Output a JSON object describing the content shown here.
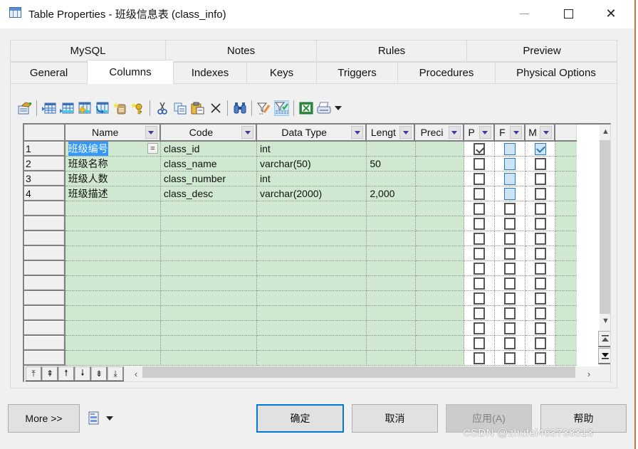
{
  "window": {
    "title": "Table Properties - 班级信息表 (class_info)",
    "icon": "table-icon",
    "controls": [
      "minimize",
      "maximize",
      "close"
    ]
  },
  "tabs": {
    "back_row": [
      "MySQL",
      "Notes",
      "Rules",
      "Preview"
    ],
    "front_row": [
      "General",
      "Columns",
      "Indexes",
      "Keys",
      "Triggers",
      "Procedures",
      "Physical Options"
    ],
    "active": "Columns"
  },
  "toolbar": {
    "items": [
      {
        "icon": "properties-icon"
      },
      {
        "sep": true
      },
      {
        "icon": "insert-row-icon"
      },
      {
        "icon": "add-row-icon"
      },
      {
        "icon": "add-rows-icon"
      },
      {
        "icon": "replace-rows-icon"
      },
      {
        "icon": "new-domain-icon"
      },
      {
        "icon": "new-key-icon"
      },
      {
        "sep": true
      },
      {
        "icon": "cut-icon"
      },
      {
        "icon": "copy-icon"
      },
      {
        "icon": "paste-icon"
      },
      {
        "icon": "delete-icon"
      },
      {
        "sep": true
      },
      {
        "icon": "find-icon"
      },
      {
        "sep": true
      },
      {
        "icon": "customize-filter-icon"
      },
      {
        "icon": "enable-filter-icon",
        "active": true
      },
      {
        "sep": true
      },
      {
        "icon": "export-excel-icon"
      },
      {
        "icon": "print-icon"
      },
      {
        "icon": "dropdown-arrow-icon"
      }
    ]
  },
  "grid": {
    "columns": [
      "Name",
      "Code",
      "Data Type",
      "Lengt",
      "Preci",
      "P",
      "F",
      "M"
    ],
    "rows": [
      {
        "num": "1",
        "name": "班级编号",
        "code": "class_id",
        "data_type": "int",
        "length": "",
        "precision": "",
        "p": true,
        "f": false,
        "m": true
      },
      {
        "num": "2",
        "name": "班级名称",
        "code": "class_name",
        "data_type": "varchar(50)",
        "length": "50",
        "precision": "",
        "p": false,
        "f": false,
        "m": false
      },
      {
        "num": "3",
        "name": "班级人数",
        "code": "class_number",
        "data_type": "int",
        "length": "",
        "precision": "",
        "p": false,
        "f": false,
        "m": false
      },
      {
        "num": "4",
        "name": "班级描述",
        "code": "class_desc",
        "data_type": "varchar(2000)",
        "length": "2,000",
        "precision": "",
        "p": false,
        "f": false,
        "m": false
      }
    ],
    "empty_rows": 11,
    "selected_cell_marker": "="
  },
  "buttons": {
    "more": "More >>",
    "ok": "确定",
    "cancel": "取消",
    "apply": "应用(A)",
    "help": "帮助"
  },
  "watermark": "CSDN @zhufei463738313"
}
